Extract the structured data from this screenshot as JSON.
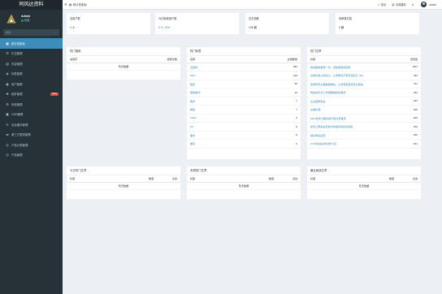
{
  "sidebar": {
    "brand": "阿风达资料",
    "user_name": "Admin",
    "user_status": "在线",
    "search_placeholder": "搜索...",
    "items": [
      {
        "label": "统计控制台",
        "icon": "dashboard-icon",
        "glyph": "▦",
        "active": true
      },
      {
        "label": "栏目管理",
        "icon": "list-icon",
        "glyph": "☰"
      },
      {
        "label": "内容管理",
        "icon": "document-icon",
        "glyph": "▤"
      },
      {
        "label": "标签管理",
        "icon": "tag-icon",
        "glyph": "◈"
      },
      {
        "label": "用户管理",
        "icon": "user-icon",
        "glyph": "◉"
      },
      {
        "label": "插件管理",
        "icon": "plugin-icon",
        "glyph": "✚",
        "badge": "NEW"
      },
      {
        "label": "系统管理",
        "icon": "gear-icon",
        "glyph": "⚙"
      },
      {
        "label": "CMS管理",
        "icon": "cms-icon",
        "glyph": "▣"
      },
      {
        "label": "后台缓存管理",
        "icon": "cache-icon",
        "glyph": "↻"
      },
      {
        "label": "第三方登录管理",
        "icon": "login-icon",
        "glyph": "⇄"
      },
      {
        "label": "产品分类管理",
        "icon": "category-icon",
        "glyph": "◎"
      },
      {
        "label": "产品管理",
        "icon": "product-icon",
        "glyph": "◎"
      }
    ]
  },
  "topbar": {
    "breadcrumb": "统计控制台",
    "home_label": "前台",
    "clear_cache_label": "清除缓存",
    "user_label": "admin"
  },
  "stats": [
    {
      "label": "总用户数",
      "value": "1 人",
      "green": false
    },
    {
      "label": "今日新增用户数",
      "value": "0 人 +0%",
      "green": true
    },
    {
      "label": "总文档数",
      "value": "128 篇",
      "green": false
    },
    {
      "label": "待审核文档",
      "value": "0 篇",
      "green": false
    }
  ],
  "hot_search": {
    "title": "热门搜索",
    "col_keyword": "关键字",
    "col_count": "搜索次数",
    "empty": "暂无数据"
  },
  "hot_tags": {
    "title": "热门标签",
    "col_name": "名称",
    "col_count": "文档数量",
    "rows": [
      {
        "name": "无敌的",
        "count": "289"
      },
      {
        "name": "SEO",
        "count": "128"
      },
      {
        "name": "程序",
        "count": "96"
      },
      {
        "name": "模板制作",
        "count": "18"
      },
      {
        "name": "教学",
        "count": "7"
      },
      {
        "name": "模板",
        "count": "7"
      },
      {
        "name": "bilibili",
        "count": "6"
      },
      {
        "name": "PC",
        "count": "6"
      },
      {
        "name": "国内",
        "count": "6"
      },
      {
        "name": "国际",
        "count": "6"
      }
    ]
  },
  "hot_articles": {
    "title": "热门文章",
    "col_title": "标题",
    "col_views": "浏览量",
    "rows": [
      {
        "title": "网站模板推荐一份，值得借鉴的使用",
        "views": "1181"
      },
      {
        "title": "这些功能让你感兴，让你再也不想花钱买它 (16)",
        "views": "332"
      },
      {
        "title": "使用阿风达模板做网站，让你轻松搭建专业网站",
        "views": "311"
      },
      {
        "title": "网站的优化工作需要做到的事项",
        "views": "292"
      },
      {
        "title": "企业官网建设",
        "views": "232"
      },
      {
        "title": "文章标题",
        "views": "208"
      },
      {
        "title": "SEO优化方面的技巧和注意事项",
        "views": "206"
      },
      {
        "title": "如何让网站在百度中快速获得好的排名",
        "views": "205"
      },
      {
        "title": "做好网站运营",
        "views": "205"
      },
      {
        "title": "CMS建站系统功能介绍",
        "views": "201"
      }
    ]
  },
  "today_articles": {
    "title": "今日热门文章",
    "col_title": "标题",
    "col_count": "数量",
    "col_unit": "点击",
    "empty": "暂无数据"
  },
  "weekly_articles": {
    "title": "本周热门文章",
    "col_title": "标题",
    "col_count": "数量",
    "col_unit": "点击",
    "empty": "暂无数据"
  },
  "recent_reads": {
    "title": "最近阅读文章",
    "col_title": "标题",
    "col_count": "数量",
    "col_unit": "点击",
    "empty": "暂无数据"
  }
}
